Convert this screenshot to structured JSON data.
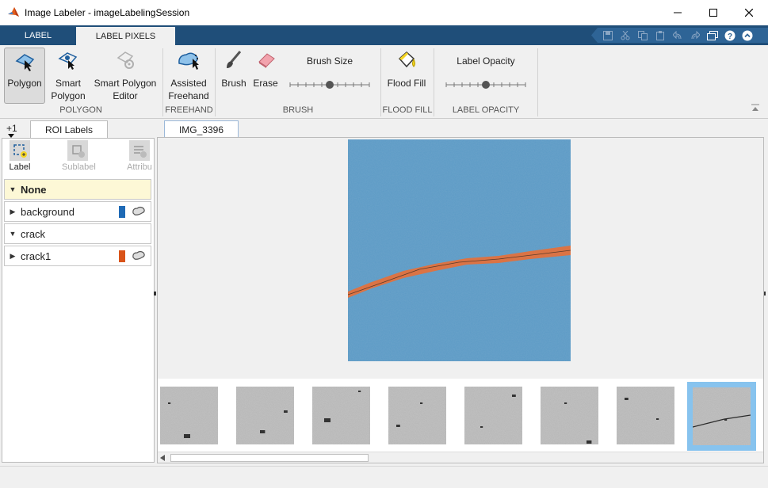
{
  "window": {
    "title": "Image Labeler - imageLabelingSession",
    "minimize_icon": "minimize-icon",
    "maximize_icon": "maximize-icon",
    "close_icon": "close-icon"
  },
  "tabs": [
    {
      "label": "LABEL",
      "active": false
    },
    {
      "label": "LABEL PIXELS",
      "active": true
    }
  ],
  "quick_access": [
    "save-icon",
    "cut-icon",
    "copy-icon",
    "paste-icon",
    "undo-icon",
    "redo-icon",
    "restore-icon",
    "help-icon",
    "collapse-icon"
  ],
  "ribbon": {
    "polygon": {
      "line1": "Polygon"
    },
    "smart_polygon": {
      "line1": "Smart",
      "line2": "Polygon"
    },
    "smart_polygon_editor": {
      "line1": "Smart Polygon",
      "line2": "Editor"
    },
    "assisted_freehand": {
      "line1": "Assisted",
      "line2": "Freehand"
    },
    "brush": "Brush",
    "erase": "Erase",
    "brush_size": {
      "label": "Brush Size",
      "level": 0.5
    },
    "flood_fill": "Flood Fill",
    "label_opacity": {
      "label": "Label Opacity",
      "level": 0.5
    },
    "groups": [
      "POLYGON",
      "FREEHAND",
      "BRUSH",
      "FLOOD FILL",
      "LABEL OPACITY"
    ]
  },
  "left_panel": {
    "plus": "+1",
    "tab": "ROI Labels",
    "tools": {
      "label": "Label",
      "sublabel": "Sublabel",
      "attribute": "Attribu"
    },
    "rows": [
      {
        "name": "None",
        "kind": "group-header",
        "expanded": true
      },
      {
        "name": "background",
        "kind": "label",
        "color": "#1f6ab5"
      },
      {
        "name": "crack",
        "kind": "group-header",
        "expanded": true
      },
      {
        "name": "crack1",
        "kind": "label",
        "color": "#d95319"
      }
    ]
  },
  "main": {
    "tab": "IMG_3396",
    "thumbnail_count": 8,
    "selected_thumbnail": 8
  },
  "colors": {
    "tab_bar": "#1f4e79",
    "background_label": "#1f6ab5",
    "crack_label": "#d95319",
    "selected_thumb": "#87c3ee"
  }
}
